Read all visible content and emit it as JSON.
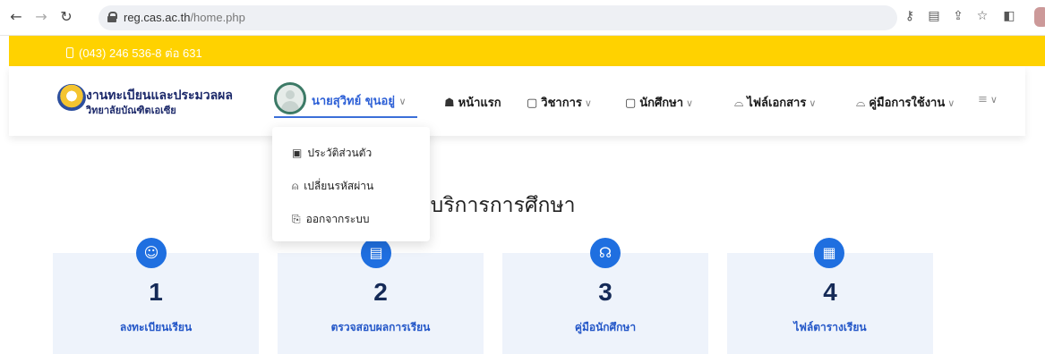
{
  "browser": {
    "url_domain": "reg.cas.ac.th",
    "url_path": "/home.php"
  },
  "topbar": {
    "phone": "(043) 246 536-8 ต่อ 631"
  },
  "header": {
    "brand_line1": "งานทะเบียนและประมวลผล",
    "brand_line2": "วิทยาลัยบัณฑิตเอเซีย",
    "user_name": "นายสุวิทย์  ขุนอยู่",
    "menu": [
      {
        "icon": "home-icon",
        "label": "หน้าแรก"
      },
      {
        "icon": "book-icon",
        "label": "วิชาการ"
      },
      {
        "icon": "student-icon",
        "label": "นักศึกษา"
      },
      {
        "icon": "file-icon",
        "label": "ไฟล์เอกสาร"
      },
      {
        "icon": "manual-icon",
        "label": "คู่มือการใช้งาน"
      }
    ]
  },
  "dropdown": {
    "items": [
      {
        "icon": "profile-icon",
        "label": "ประวัติส่วนตัว"
      },
      {
        "icon": "lock-icon",
        "label": "เปลี่ยนรหัสผ่าน"
      },
      {
        "icon": "logout-icon",
        "label": "ออกจากระบบ"
      }
    ]
  },
  "section": {
    "title": "บบริการการศึกษา"
  },
  "cards": [
    {
      "number": "1",
      "label": "ลงทะเบียนเรียน",
      "icon": "users-icon"
    },
    {
      "number": "2",
      "label": "ตรวจสอบผลการเรียน",
      "icon": "clipboard-icon"
    },
    {
      "number": "3",
      "label": "คู่มือนักศึกษา",
      "icon": "headset-icon"
    },
    {
      "number": "4",
      "label": "ไฟล์ตารางเรียน",
      "icon": "document-icon"
    }
  ],
  "colors": {
    "topbar": "#ffd200",
    "accent": "#1f6fe0",
    "card_bg": "#eef3fb"
  }
}
